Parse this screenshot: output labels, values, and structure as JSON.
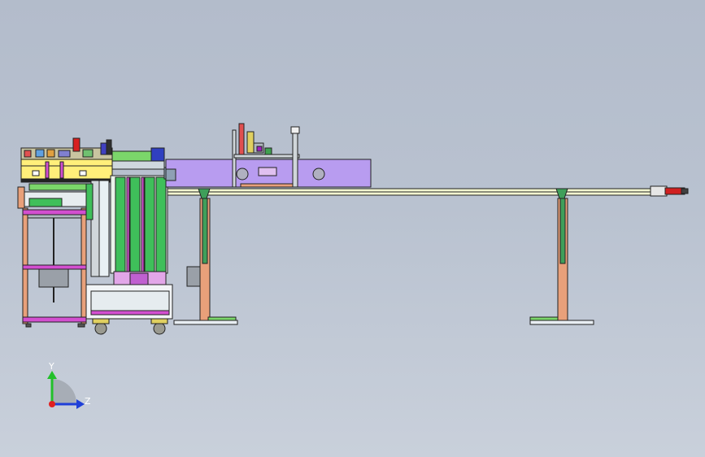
{
  "viewport": {
    "background_top": "#b3bccb",
    "background_bottom": "#c9d0db"
  },
  "triad": {
    "y_label": "Y",
    "z_label": "Z",
    "y_color": "#22c02a",
    "z_color": "#1f3fd8",
    "origin_color": "#e02020"
  },
  "colors": {
    "frame_orange": "#e8a07a",
    "rail_green": "#7bd66a",
    "lavender_panel": "#b89cf0",
    "stack_green": "#3fbf5a",
    "magenta": "#d34fd0",
    "yellow_panel": "#ffef7a",
    "base_white": "#e8eef3"
  }
}
